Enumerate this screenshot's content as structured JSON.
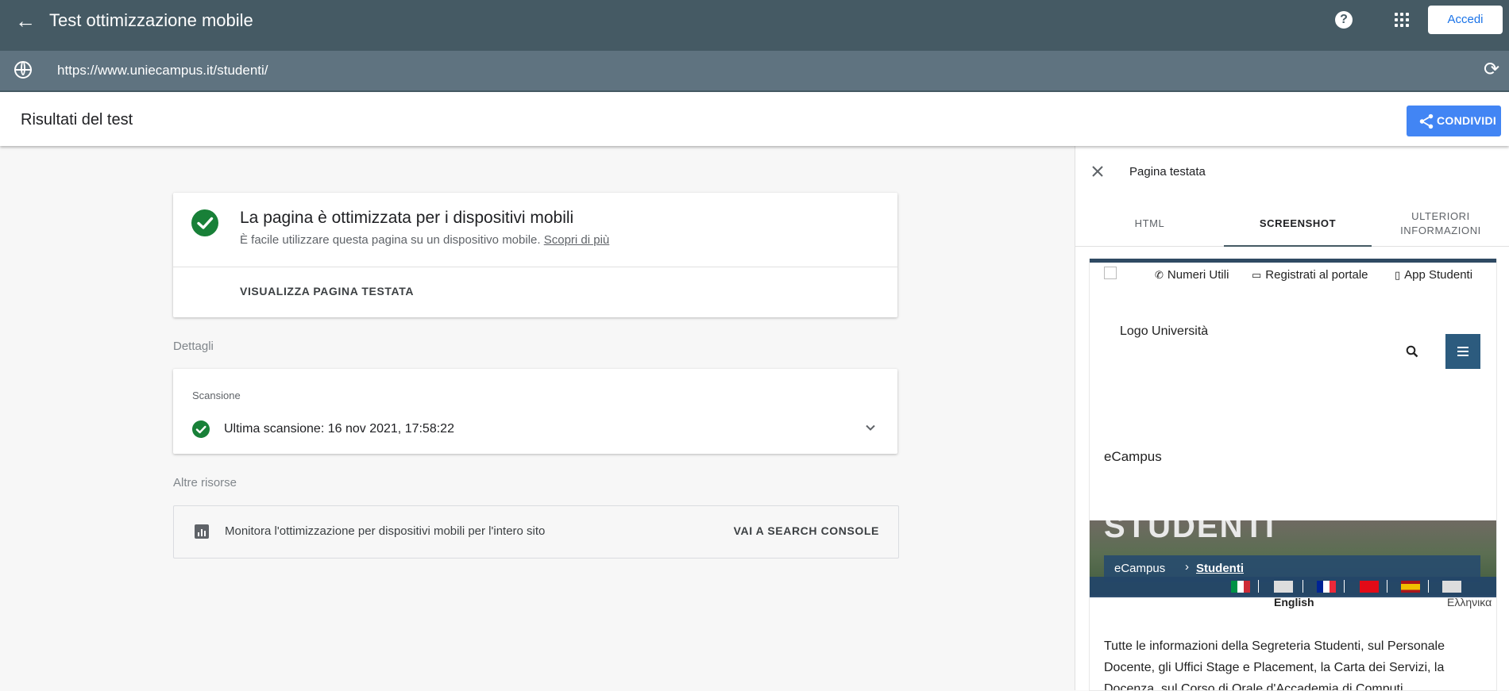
{
  "topbar": {
    "back_icon": "arrow-left-icon",
    "title": "Test ottimizzazione mobile",
    "help_label": "?",
    "login_label": "Accedi"
  },
  "urlbar": {
    "url": "https://www.uniecampus.it/studenti/",
    "reload_glyph": "⟳"
  },
  "results": {
    "title": "Risultati del test",
    "share_label": "CONDIVIDI"
  },
  "summary": {
    "heading": "La pagina è ottimizzata per i dispositivi mobili",
    "subtext": "È facile utilizzare questa pagina su un dispositivo mobile.",
    "learn_more": "Scopri di più",
    "view_page": "VISUALIZZA PAGINA TESTATA"
  },
  "details": {
    "section_label": "Dettagli",
    "scan_label": "Scansione",
    "scan_text": "Ultima scansione: 16 nov 2021, 17:58:22"
  },
  "resources": {
    "section_label": "Altre risorse",
    "text": "Monitora l'ottimizzazione per dispositivi mobili per l'intero sito",
    "link": "VAI A SEARCH CONSOLE"
  },
  "panel": {
    "title": "Pagina testata",
    "tabs": [
      {
        "label": "HTML"
      },
      {
        "label": "SCREENSHOT"
      },
      {
        "label": "ULTERIORI INFORMAZIONI"
      }
    ],
    "selected_tab": "SCREENSHOT",
    "screenshot": {
      "util_links": [
        "Numeri Utili",
        "Registrati al portale",
        "App Studenti"
      ],
      "logo_alt": "Logo Università",
      "site_name": "eCampus",
      "hero_title": "STUDENTI",
      "breadcrumb": [
        "eCampus",
        "Studenti"
      ],
      "breadcrumb_sep": "›",
      "languages": [
        "English",
        "Ελληνικα"
      ],
      "paragraph": "Tutte le informazioni della Segreteria Studenti, sul Personale Docente, gli Uffici Stage e Placement, la Carta dei Servizi, la Docenza, sul Corso di Orale d'Accademia di Computi"
    }
  },
  "colors": {
    "header": "#455a64",
    "url_bar": "#5f7380",
    "success": "#188038",
    "share": "#4285f4",
    "site_nav": "#2c5b7e"
  }
}
